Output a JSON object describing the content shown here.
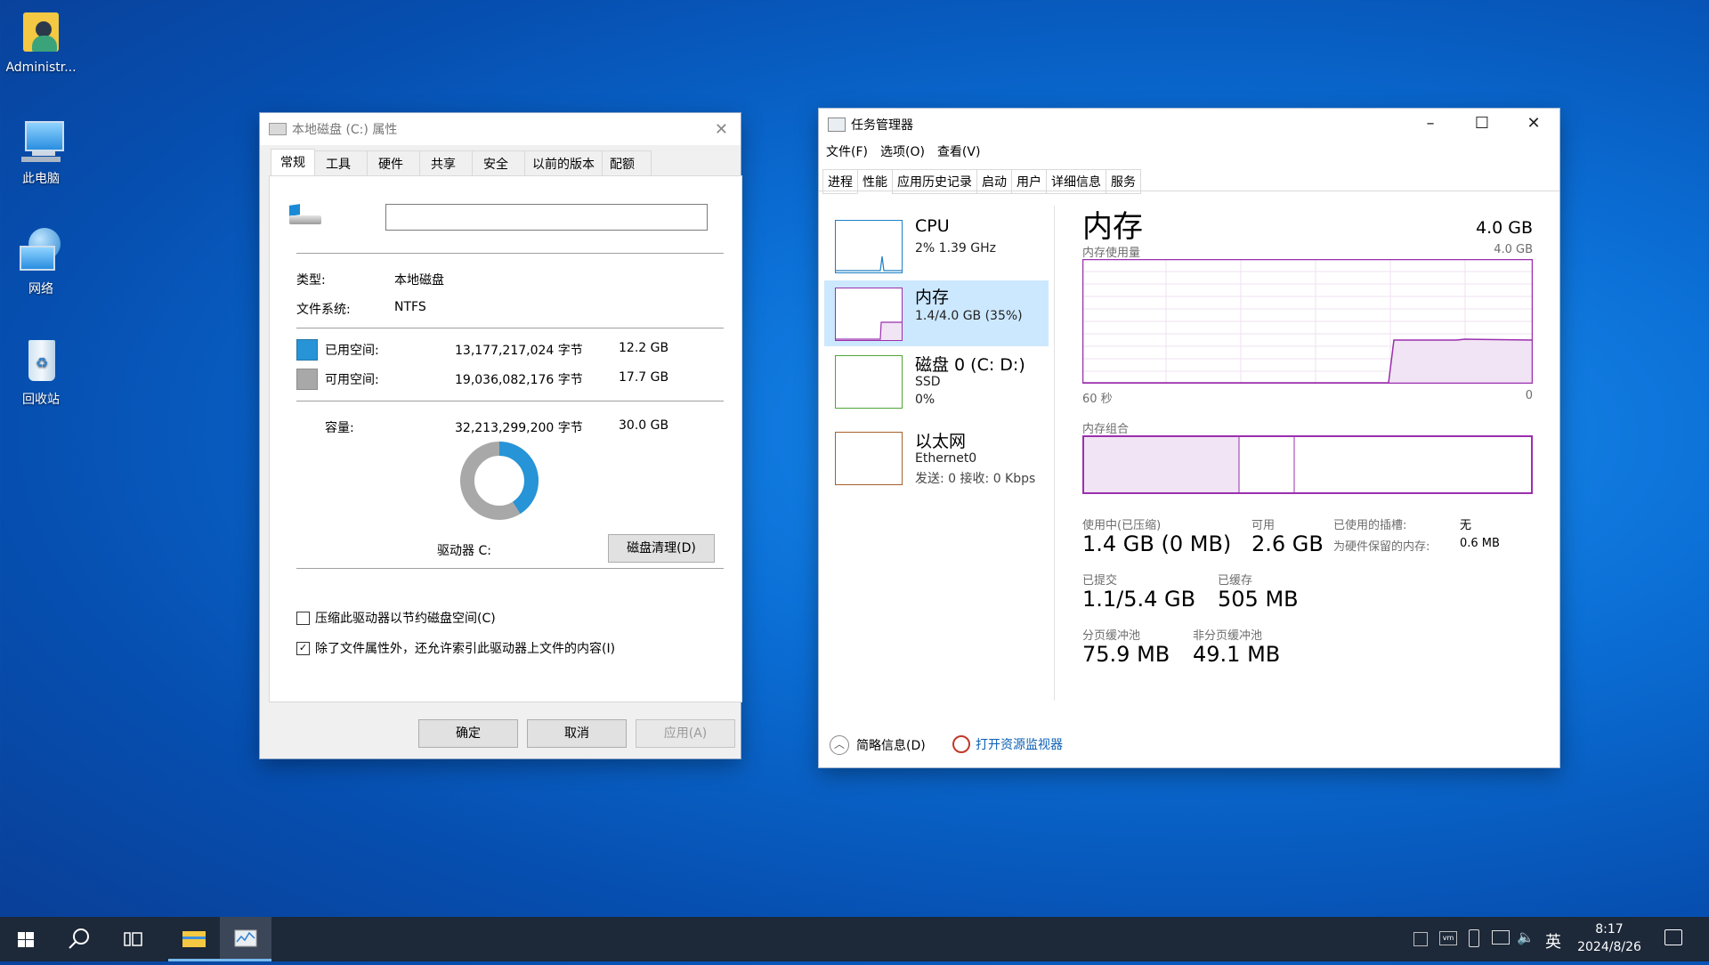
{
  "desktop": {
    "icons": [
      {
        "label": "Administr..."
      },
      {
        "label": "此电脑"
      },
      {
        "label": "网络"
      },
      {
        "label": "回收站"
      }
    ]
  },
  "props": {
    "title": "本地磁盘 (C:) 属性",
    "tabs": [
      "常规",
      "工具",
      "硬件",
      "共享",
      "安全",
      "以前的版本",
      "配额"
    ],
    "name_value": "",
    "type_label": "类型:",
    "type_value": "本地磁盘",
    "fs_label": "文件系统:",
    "fs_value": "NTFS",
    "used_label": "已用空间:",
    "used_bytes": "13,177,217,024 字节",
    "used_gb": "12.2 GB",
    "free_label": "可用空间:",
    "free_bytes": "19,036,082,176 字节",
    "free_gb": "17.7 GB",
    "cap_label": "容量:",
    "cap_bytes": "32,213,299,200 字节",
    "cap_gb": "30.0 GB",
    "used_fraction": 0.409,
    "drive_label": "驱动器 C:",
    "cleanup_button": "磁盘清理(D)",
    "compress_label": "压缩此驱动器以节约磁盘空间(C)",
    "compress_checked": false,
    "index_label": "除了文件属性外，还允许索引此驱动器上文件的内容(I)",
    "index_checked": true,
    "ok_button": "确定",
    "cancel_button": "取消",
    "apply_button": "应用(A)",
    "colors": {
      "used": "#2694d7",
      "free": "#a8a8a8"
    }
  },
  "taskmgr": {
    "title": "任务管理器",
    "menu": [
      "文件(F)",
      "选项(O)",
      "查看(V)"
    ],
    "tabs": [
      "进程",
      "性能",
      "应用历史记录",
      "启动",
      "用户",
      "详细信息",
      "服务"
    ],
    "side": [
      {
        "name": "CPU",
        "sub1": "2% 1.39 GHz",
        "sub2": ""
      },
      {
        "name": "内存",
        "sub1": "1.4/4.0 GB (35%)",
        "sub2": ""
      },
      {
        "name": "磁盘 0 (C: D:)",
        "sub1": "SSD",
        "sub2": "0%"
      },
      {
        "name": "以太网",
        "sub1": "Ethernet0",
        "sub2": "发送: 0 接收: 0 Kbps"
      }
    ],
    "main": {
      "heading": "内存",
      "total": "4.0 GB",
      "usage_label": "内存使用量",
      "usage_max": "4.0 GB",
      "axis_left": "60 秒",
      "axis_right": "0",
      "composition_label": "内存组合",
      "in_use_label": "使用中(已压缩)",
      "in_use_value": "1.4 GB (0 MB)",
      "avail_label": "可用",
      "avail_value": "2.6 GB",
      "slots_label": "已使用的插槽:",
      "slots_value": "无",
      "reserved_label": "为硬件保留的内存:",
      "reserved_value": "0.6 MB",
      "committed_label": "已提交",
      "committed_value": "1.1/5.4 GB",
      "cached_label": "已缓存",
      "cached_value": "505 MB",
      "paged_label": "分页缓冲池",
      "paged_value": "75.9 MB",
      "nonpaged_label": "非分页缓冲池",
      "nonpaged_value": "49.1 MB"
    },
    "footer": {
      "summary": "简略信息(D)",
      "monitor": "打开资源监视器"
    },
    "accent": "#9b2fae"
  },
  "taskbar": {
    "lang": "英",
    "time": "8:17",
    "date": "2024/8/26"
  }
}
